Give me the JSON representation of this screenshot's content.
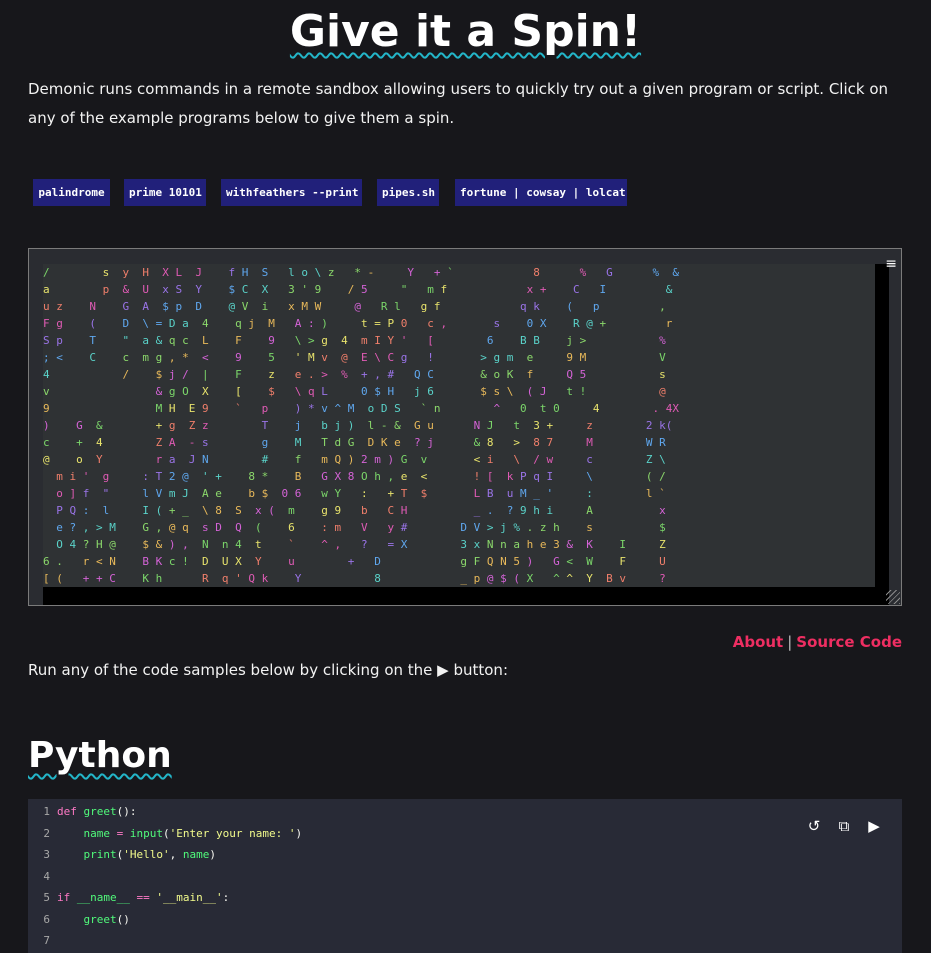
{
  "header": {
    "title": "Give it a Spin!",
    "intro": "Demonic runs commands in a remote sandbox allowing users to quickly try out a given program or script. Click on any of the example programs below to give them a spin."
  },
  "examples": [
    {
      "label": "palindrome"
    },
    {
      "label": "prime 10101"
    },
    {
      "label": "withfeathers --print"
    },
    {
      "label": "pipes.sh"
    },
    {
      "label": "fortune | cowsay | lolcat"
    }
  ],
  "terminal": {
    "menu_icon": "hamburger-icon",
    "rain": [
      "/        s  y  H  X L  J    f H  S   l o \\ z   * -     Y   + `            8      %   G      %  &",
      "a        p  &  U  x S  Y    $ C  X   3 ' 9    / 5     \"   m f            x +    C   I         &",
      "u z    N    G  A  $ p  D    @ V  i   x M W     @   R l   g f            q k    (   p         ,",
      "F g    (    D  \\ = D a  4    q j  M   A : )     t = P 0   c ,       s    0 X    R @ +         r",
      "S p    T    \"  a & q c  L    F    9   \\ > g  4  m I Y '   [        6    B B    j >           %",
      "; <    C    c  m g , *  <    9    5   ' M v  @  E \\ C g   !       > g m  e     9 M           V",
      "4           /    $ j /  |    F    z   e . >  %  + , #   Q C       & o K  f     Q 5           s",
      "v                & g O  X    [    $   \\ q L     0 $ H   j 6       $ s \\  ( J   t !           @",
      "9                M H  E 9    `   p    ) * v ^ M  o D S   ` n        ^   0  t 0     4        . 4X",
      ")    G  &        + g  Z z        T    j   b j )  l - &  G u      N J   t  3 +     z        2 k(",
      "c    +  4        Z A  - s        g    M   T d G  D K e  ? j      & 8   >  8 7     M        W R",
      "@    o  Y        r a  J N        #    f   m Q ) 2 m ) G  v       < i   \\  / w     c        Z \\",
      "  m i '  g     : T 2 @  ' +    8 *    B   G X 8 O h , e  <       ! [  k P q I     \\        ( /",
      "  o ] f  \"     l V m J  A e    b $  0 6   w Y   :   + T  $       L B  u M _ '     :        l `",
      "  P Q :  l     I ( + _  \\ 8  S  x (  m    g 9   b   C H          _ .  ? 9 h i     A          x",
      "  e ? , > M    G , @ q  s D  Q  (    6    : m   V   y #        D V > j % . z h    s          $",
      "  O 4 ? H @    $ & ) ,  N  n 4  t    `    ^ ,   ?   = X        3 x N n a h e 3 &  K    I     Z",
      "6 .   r < N    B K c !  D  U X  Y    u        +   D            g F Q N 5 )   G <  W    F     U",
      "[ (   + + C    K h      R  q ' Q k    Y           8            _ p @ $ ( X   ^ ^  Y  B v     ?"
    ]
  },
  "links": {
    "about": "About",
    "separator": "|",
    "source": "Source Code"
  },
  "run_hint": "Run any of the code samples below by clicking on the ▶ button:",
  "section": {
    "title": "Python"
  },
  "code": {
    "language": "python",
    "lines": [
      {
        "n": "1",
        "text": "def greet():"
      },
      {
        "n": "2",
        "text": "    name = input('Enter your name: ')"
      },
      {
        "n": "3",
        "text": "    print('Hello', name)"
      },
      {
        "n": "4",
        "text": ""
      },
      {
        "n": "5",
        "text": "if __name__ == '__main__':"
      },
      {
        "n": "6",
        "text": "    greet()"
      },
      {
        "n": "7",
        "text": ""
      }
    ],
    "tools": [
      {
        "icon": "reset-icon",
        "glyph": "↺"
      },
      {
        "icon": "copy-icon",
        "glyph": "⧉"
      },
      {
        "icon": "play-icon",
        "glyph": "▶"
      }
    ]
  },
  "colors": {
    "background": "#17171b",
    "button_bg": "#21207a",
    "link": "#ee2e62",
    "code_bg": "#282a36",
    "title_underline": "#23b5c8"
  }
}
